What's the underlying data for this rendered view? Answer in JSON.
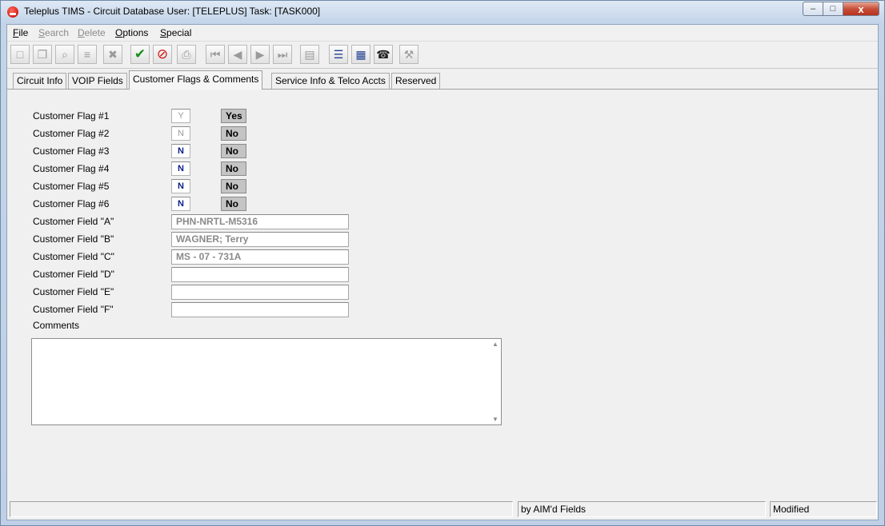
{
  "window": {
    "title": "Teleplus TIMS - Circuit Database  User: [TELEPLUS]  Task: [TASK000]",
    "min_glyph": "–",
    "max_glyph": "□",
    "close_glyph": "x"
  },
  "menu": [
    {
      "accel": "F",
      "rest": "ile",
      "enabled": true
    },
    {
      "accel": "S",
      "rest": "earch",
      "enabled": false
    },
    {
      "accel": "D",
      "rest": "elete",
      "enabled": false
    },
    {
      "accel": "O",
      "rest": "ptions",
      "enabled": true
    },
    {
      "accel": "S",
      "rest": "pecial",
      "enabled": true
    }
  ],
  "toolbar": {
    "icons": [
      "new-record-icon",
      "copy-record-icon",
      "find-icon",
      "view-icon",
      "delete-icon",
      "accept-icon",
      "cancel-icon",
      "print-icon",
      "first-record-icon",
      "previous-record-icon",
      "next-record-icon",
      "last-record-icon",
      "table-view-icon",
      "query-icon",
      "grid-icon",
      "phone-icon",
      "tools-icon"
    ],
    "glyphs": [
      "□",
      "❐",
      "⌕",
      "≡",
      "✖",
      "✔",
      "⊘",
      "⎙",
      "⏮",
      "◀",
      "▶",
      "⏭",
      "▤",
      "☰",
      "▦",
      "☎",
      "⚒"
    ],
    "colors": {
      "accept": "#1a8f1a",
      "cancel": "#d01010"
    }
  },
  "tabs": [
    "Circuit Info",
    "VOIP Fields",
    "Customer Flags & Comments",
    "Service Info & Telco Accts",
    "Reserved"
  ],
  "selected_tab": 2,
  "flags": [
    {
      "label": "Customer Flag #1",
      "value": "Y",
      "display": "Yes",
      "readonly": true
    },
    {
      "label": "Customer Flag #2",
      "value": "N",
      "display": "No",
      "readonly": true
    },
    {
      "label": "Customer Flag #3",
      "value": "N",
      "display": "No",
      "readonly": false
    },
    {
      "label": "Customer Flag #4",
      "value": "N",
      "display": "No",
      "readonly": false
    },
    {
      "label": "Customer Flag #5",
      "value": "N",
      "display": "No",
      "readonly": false
    },
    {
      "label": "Customer Flag #6",
      "value": "N",
      "display": "No",
      "readonly": false
    }
  ],
  "fields": [
    {
      "label": "Customer Field \"A\"",
      "value": "PHN-NRTL-M5316"
    },
    {
      "label": "Customer Field \"B\"",
      "value": "WAGNER; Terry"
    },
    {
      "label": "Customer Field \"C\"",
      "value": "MS - 07 - 731A"
    },
    {
      "label": "Customer Field \"D\"",
      "value": ""
    },
    {
      "label": "Customer Field \"E\"",
      "value": ""
    },
    {
      "label": "Customer Field \"F\"",
      "value": ""
    }
  ],
  "comments": {
    "label": "Comments",
    "value": ""
  },
  "status": {
    "panel1": "",
    "panel2": "by AIM'd Fields",
    "panel3": "Modified"
  }
}
